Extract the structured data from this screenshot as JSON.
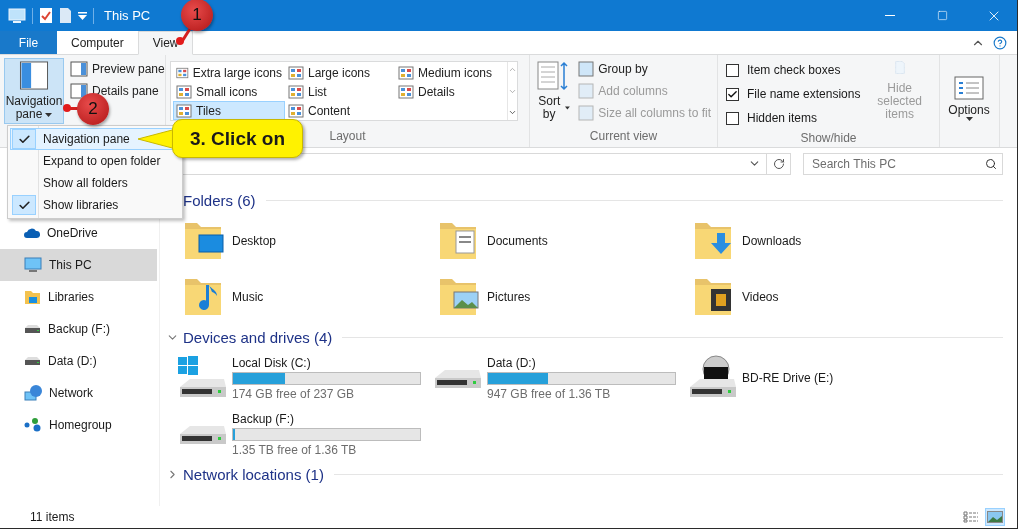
{
  "window": {
    "title": "This PC"
  },
  "ribbon_tabs": [
    {
      "label": "File",
      "kind": "file",
      "selected": false
    },
    {
      "label": "Computer",
      "kind": "tab",
      "selected": false
    },
    {
      "label": "View",
      "kind": "tab",
      "selected": true
    }
  ],
  "ribbon": {
    "panes": {
      "navigation_pane": {
        "label": "Navigation pane",
        "selected": true
      },
      "items": [
        "Preview pane",
        "Details pane"
      ]
    },
    "layout": {
      "label": "Layout",
      "options": [
        {
          "label": "Extra large icons",
          "selected": false
        },
        {
          "label": "Large icons",
          "selected": false
        },
        {
          "label": "Medium icons",
          "selected": false
        },
        {
          "label": "Small icons",
          "selected": false
        },
        {
          "label": "List",
          "selected": false
        },
        {
          "label": "Details",
          "selected": false
        },
        {
          "label": "Tiles",
          "selected": true
        },
        {
          "label": "Content",
          "selected": false
        }
      ]
    },
    "current_view": {
      "label": "Current view",
      "sort": "Sort by",
      "items": [
        {
          "label": "Group by",
          "disabled": false
        },
        {
          "label": "Add columns",
          "disabled": true
        },
        {
          "label": "Size all columns to fit",
          "disabled": true
        }
      ]
    },
    "show_hide": {
      "label": "Show/hide",
      "checkboxes": [
        {
          "label": "Item check boxes",
          "checked": false
        },
        {
          "label": "File name extensions",
          "checked": true
        },
        {
          "label": "Hidden items",
          "checked": false
        }
      ],
      "hide_selected": {
        "label": "Hide selected items",
        "disabled": true
      }
    },
    "options": {
      "label": "Options"
    }
  },
  "menu": {
    "items": [
      {
        "label": "Navigation pane",
        "checked": true,
        "selected": true
      },
      {
        "label": "Expand to open folder",
        "checked": false,
        "selected": false
      },
      {
        "label": "Show all folders",
        "checked": false,
        "selected": false
      },
      {
        "label": "Show libraries",
        "checked": true,
        "selected": false
      }
    ]
  },
  "address": {
    "search_placeholder": "Search This PC"
  },
  "sidebar": {
    "items": [
      {
        "label": "OneDrive",
        "kind": "cloud",
        "selected": false
      },
      {
        "label": "This PC",
        "kind": "pc",
        "selected": true
      },
      {
        "label": "Libraries",
        "kind": "libraries",
        "selected": false
      },
      {
        "label": "Backup (F:)",
        "kind": "drive",
        "selected": false
      },
      {
        "label": "Data (D:)",
        "kind": "drive",
        "selected": false
      },
      {
        "label": "Network",
        "kind": "network",
        "selected": false
      },
      {
        "label": "Homegroup",
        "kind": "homegroup",
        "selected": false
      }
    ]
  },
  "sections": [
    {
      "title": "Folders (6)",
      "items": [
        {
          "name": "Desktop",
          "kind": "desktop"
        },
        {
          "name": "Documents",
          "kind": "documents"
        },
        {
          "name": "Downloads",
          "kind": "downloads"
        },
        {
          "name": "Music",
          "kind": "music"
        },
        {
          "name": "Pictures",
          "kind": "pictures"
        },
        {
          "name": "Videos",
          "kind": "videos"
        }
      ]
    },
    {
      "title": "Devices and drives (4)",
      "expanded": true,
      "items": [
        {
          "name": "Local Disk (C:)",
          "kind": "system",
          "level": 0.28,
          "reading": "174 GB free of 237 GB"
        },
        {
          "name": "Data (D:)",
          "kind": "disk",
          "level": 0.32,
          "reading": "947 GB free of 1.36 TB"
        },
        {
          "name": "BD-RE Drive (E:)",
          "kind": "optical"
        },
        {
          "name": "Backup (F:)",
          "kind": "disk",
          "level": 0.01,
          "reading": "1.35 TB free of 1.36 TB"
        }
      ]
    },
    {
      "title": "Network locations (1)",
      "expanded": false
    }
  ],
  "status_bar": {
    "count": "11 items",
    "views": [
      {
        "kind": "details",
        "selected": false
      },
      {
        "kind": "large",
        "selected": true
      }
    ]
  },
  "annotations": [
    {
      "kind": "badge",
      "label": "1"
    },
    {
      "kind": "badge",
      "label": "2"
    },
    {
      "kind": "callout",
      "label": "3. Click on"
    }
  ]
}
